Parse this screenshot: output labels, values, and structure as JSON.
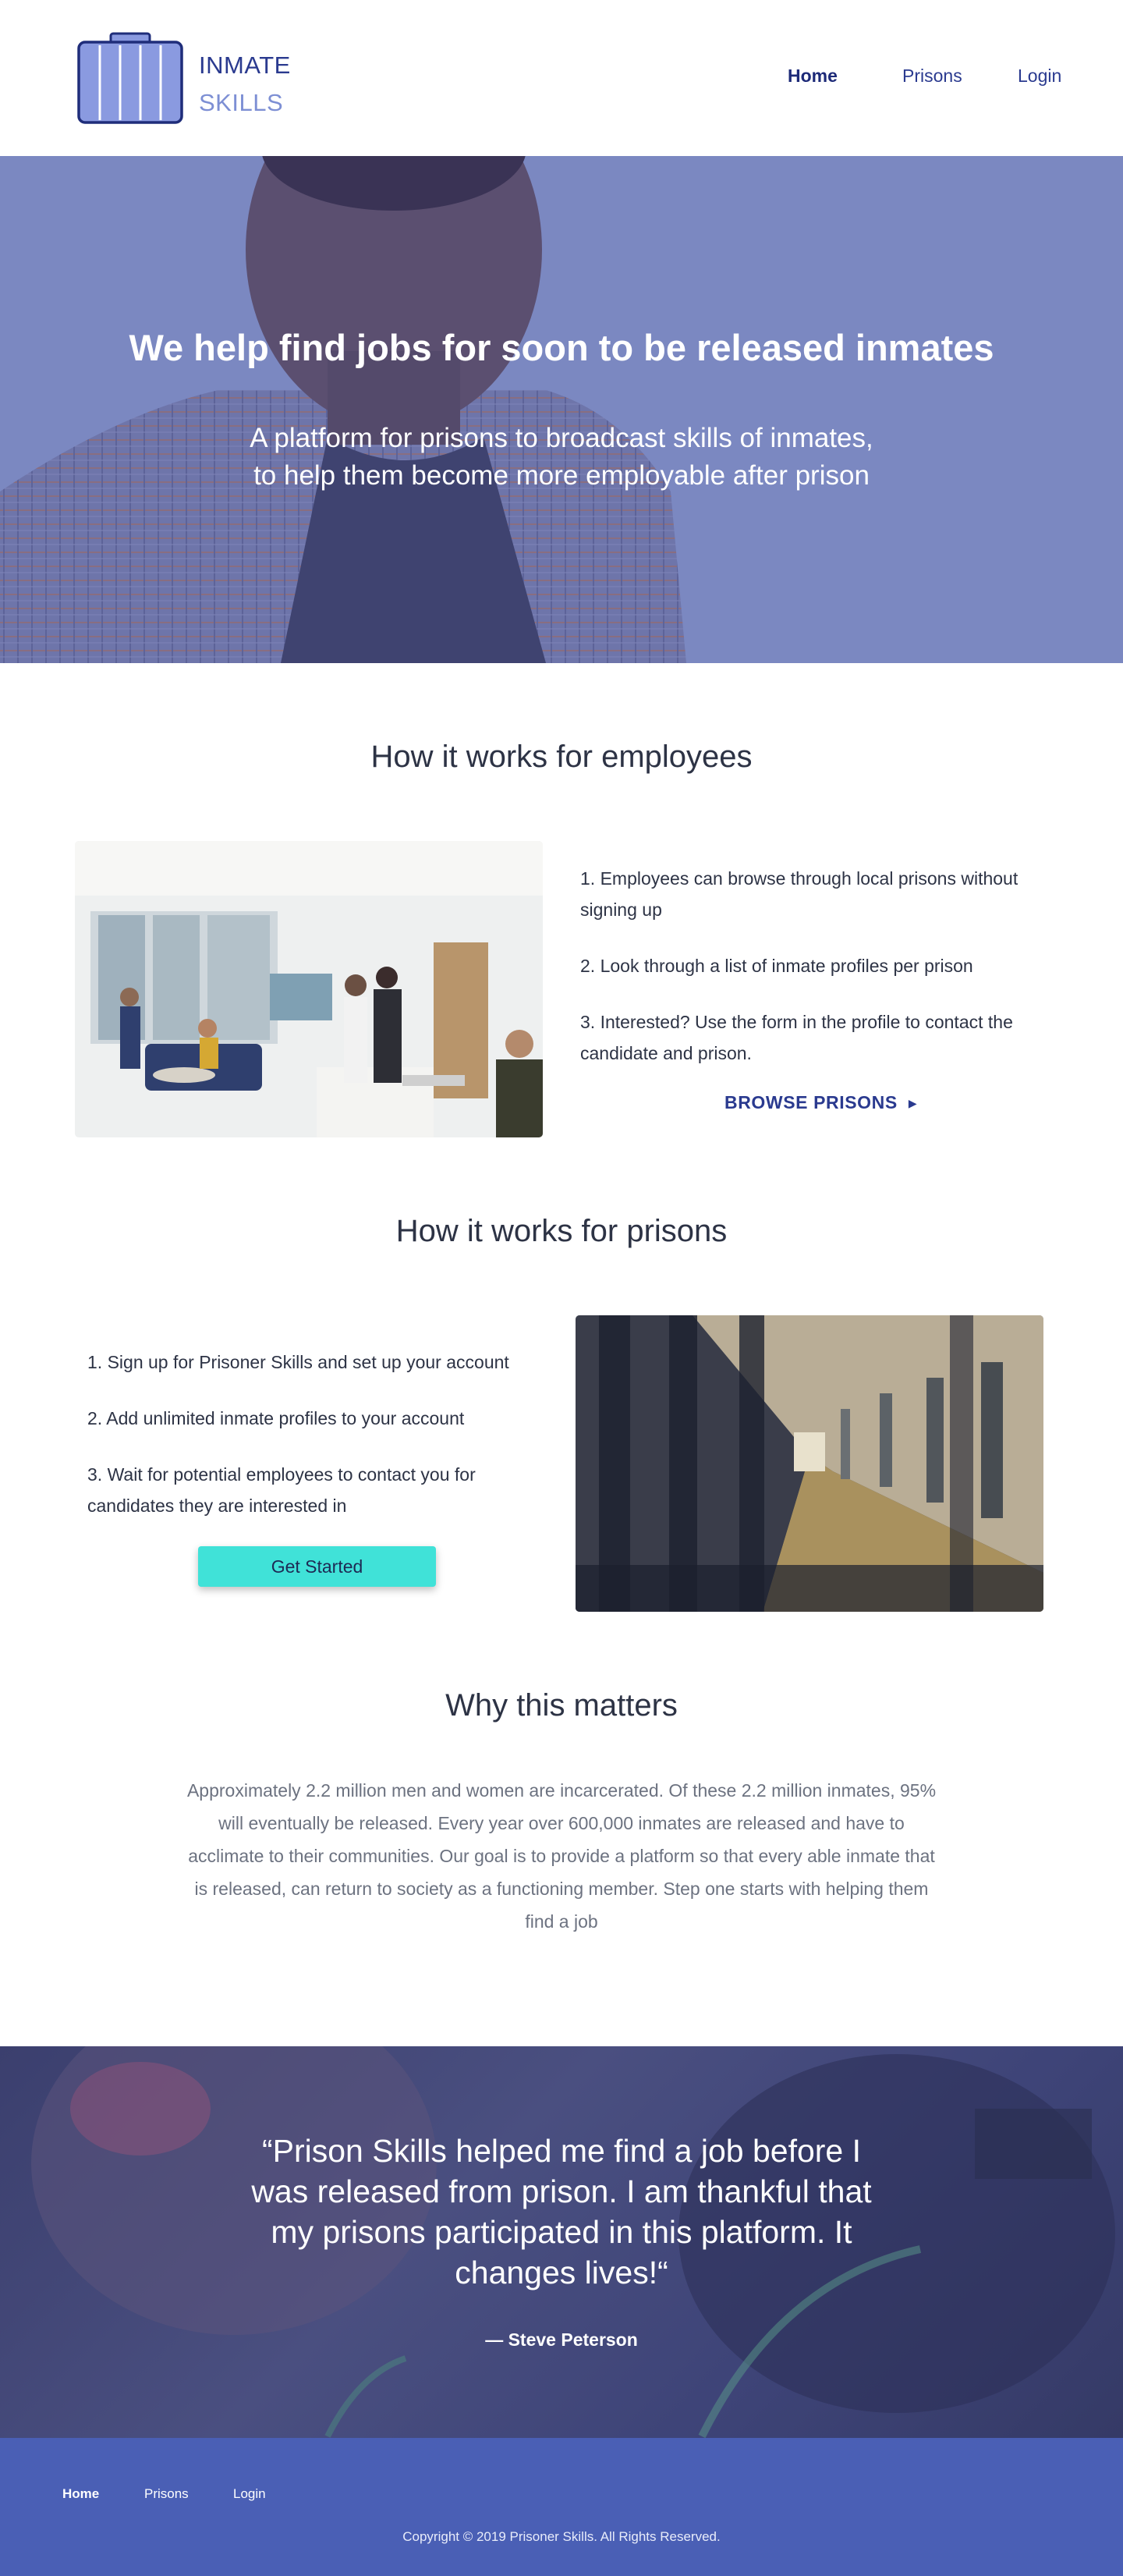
{
  "brand": {
    "line1": "INMATE",
    "line2": "SKILLS",
    "logo_icon": "briefcase-icon",
    "colors": {
      "primary": "#2a3a8f",
      "accent": "#7d8fd4",
      "cta": "#40e2d8",
      "footer": "#4a5fb5"
    }
  },
  "nav": {
    "items": [
      "Home",
      "Prisons",
      "Login"
    ],
    "active": "Home"
  },
  "hero": {
    "title": "We help find jobs for soon to be released inmates",
    "subtitle_line1": "A platform for prisons to broadcast skills of inmates,",
    "subtitle_line2": "to help them become more employable after prison"
  },
  "employees": {
    "heading": "How it works for employees",
    "steps": [
      "1. Employees can browse through local prisons without signing up",
      "2.  Look through a list of inmate profiles per prison",
      "3. Interested? Use the form in the profile to contact the candidate and prison."
    ],
    "link_label": "BROWSE PRISONS",
    "link_icon": "triangle-right-icon"
  },
  "prisons": {
    "heading": "How it works for prisons",
    "steps": [
      "1. Sign up for Prisoner Skills and set up your account",
      "2. Add unlimited inmate profiles to your account",
      "3. Wait for potential employees to contact you for candidates they are interested in"
    ],
    "button_label": "Get Started"
  },
  "why": {
    "heading": "Why this matters",
    "body": "Approximately 2.2 million men and women are incarcerated. Of these 2.2 million inmates, 95% will eventually be released. Every year over 600,000 inmates are released and have to acclimate  to their communities. Our goal is to provide a platform so that every able inmate that is released, can return to society as a functioning member. Step one starts with helping them find a job"
  },
  "testimonial": {
    "quote": "“Prison Skills helped me find a job before I was released from prison. I am thankful that my prisons participated in this platform. It changes lives!“",
    "author": "— Steve Peterson"
  },
  "footer": {
    "links": [
      "Home",
      "Prisons",
      "Login"
    ],
    "copyright": "Copyright © 2019 Prisoner Skills. All Rights Reserved."
  }
}
